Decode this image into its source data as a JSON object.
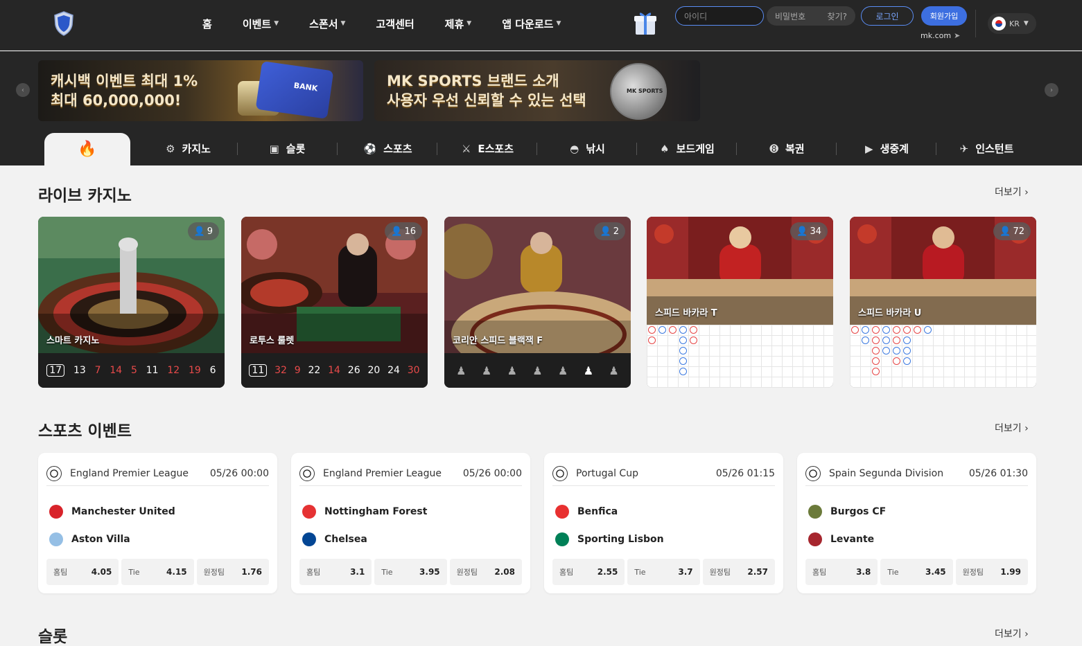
{
  "header": {
    "nav": [
      {
        "label": "홈",
        "dropdown": false
      },
      {
        "label": "이벤트",
        "dropdown": true
      },
      {
        "label": "스폰서",
        "dropdown": true
      },
      {
        "label": "고객센터",
        "dropdown": false
      },
      {
        "label": "제휴",
        "dropdown": true
      },
      {
        "label": "앱 다운로드",
        "dropdown": true
      }
    ],
    "id_placeholder": "아이디",
    "pw_placeholder": "비밀번호",
    "find_label": "찾기?",
    "login_label": "로그인",
    "join_label": "회원가입",
    "domain": "mk.com",
    "lang": "KR"
  },
  "banners": [
    {
      "line1": "캐시백 이벤트 최대 1%",
      "line2": "최대 60,000,000!",
      "badge": "BANK"
    },
    {
      "line1": "MK SPORTS 브랜드 소개",
      "line2": "사용자 우선 신뢰할 수 있는 선택",
      "badge": "MK SPORTS"
    }
  ],
  "categories": [
    "카지노",
    "슬롯",
    "스포츠",
    "E스포츠",
    "낚시",
    "보드게임",
    "복권",
    "생중계",
    "인스턴트"
  ],
  "live_casino": {
    "title": "라이브 카지노",
    "more": "더보기",
    "tables": [
      {
        "name": "스마트 카지노",
        "players": "9",
        "results": [
          [
            "17",
            "box"
          ],
          [
            "13",
            "w"
          ],
          [
            "7",
            "red"
          ],
          [
            "14",
            "red"
          ],
          [
            "5",
            "red"
          ],
          [
            "11",
            "w"
          ],
          [
            "12",
            "red"
          ],
          [
            "19",
            "red"
          ],
          [
            "6",
            "w"
          ]
        ]
      },
      {
        "name": "로투스 룰렛",
        "players": "16",
        "results": [
          [
            "11",
            "box"
          ],
          [
            "32",
            "red"
          ],
          [
            "9",
            "red"
          ],
          [
            "22",
            "w"
          ],
          [
            "14",
            "red"
          ],
          [
            "26",
            "w"
          ],
          [
            "20",
            "w"
          ],
          [
            "24",
            "w"
          ],
          [
            "30",
            "red"
          ]
        ]
      },
      {
        "name": "코리안 스피드 블랙잭 F",
        "players": "2",
        "seats": 7
      },
      {
        "name": "스피드 바카라 T",
        "players": "34"
      },
      {
        "name": "스피드 바카라 U",
        "players": "72"
      }
    ]
  },
  "sports": {
    "title": "스포츠 이벤트",
    "more": "더보기",
    "matches": [
      {
        "league": "England Premier League",
        "time": "05/26 00:00",
        "home": "Manchester United",
        "away": "Aston Villa",
        "home_label": "홈팀",
        "tie_label": "Tie",
        "away_label": "원정팀",
        "home_odd": "4.05",
        "tie_odd": "4.15",
        "away_odd": "1.76",
        "home_color": "#d8232a",
        "away_color": "#95bfe5"
      },
      {
        "league": "England Premier League",
        "time": "05/26 00:00",
        "home": "Nottingham Forest",
        "away": "Chelsea",
        "home_label": "홈팀",
        "tie_label": "Tie",
        "away_label": "원정팀",
        "home_odd": "3.1",
        "tie_odd": "3.95",
        "away_odd": "2.08",
        "home_color": "#e53233",
        "away_color": "#034694"
      },
      {
        "league": "Portugal Cup",
        "time": "05/26 01:15",
        "home": "Benfica",
        "away": "Sporting Lisbon",
        "home_label": "홈팀",
        "tie_label": "Tie",
        "away_label": "원정팀",
        "home_odd": "2.55",
        "tie_odd": "3.7",
        "away_odd": "2.57",
        "home_color": "#e83030",
        "away_color": "#008057"
      },
      {
        "league": "Spain Segunda Division",
        "time": "05/26 01:30",
        "home": "Burgos CF",
        "away": "Levante",
        "home_label": "홈팀",
        "tie_label": "Tie",
        "away_label": "원정팀",
        "home_odd": "3.8",
        "tie_odd": "3.45",
        "away_odd": "1.99",
        "home_color": "#6b7a3a",
        "away_color": "#a6262e"
      }
    ]
  },
  "slots": {
    "title": "슬롯",
    "more": "더보기"
  }
}
